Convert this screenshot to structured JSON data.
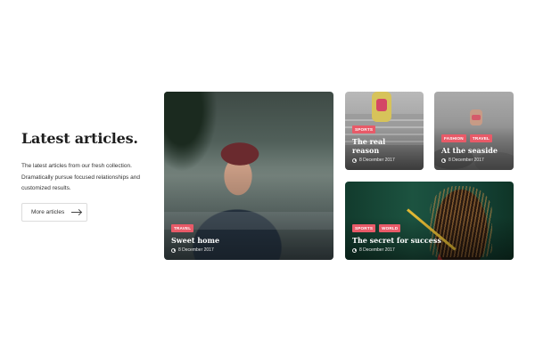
{
  "section": {
    "title": "Latest articles.",
    "description": "The latest articles from our fresh collection. Dramatically pursue focused relationships and customized results.",
    "more_button_label": "More articles"
  },
  "articles": [
    {
      "title": "Sweet home",
      "date": "8 December 2017",
      "tags": [
        "TRAVEL"
      ]
    },
    {
      "title": "The real reason",
      "date": "8 December 2017",
      "tags": [
        "SPORTS"
      ]
    },
    {
      "title": "At the seaside",
      "date": "8 December 2017",
      "tags": [
        "FASHION",
        "TRAVEL"
      ]
    },
    {
      "title": "The secret for success",
      "date": "8 December 2017",
      "tags": [
        "SPORTS",
        "WORLD"
      ]
    }
  ],
  "colors": {
    "tag": "#e85a68",
    "heading": "#1e1e1e",
    "background": "#ffffff"
  },
  "icons": {
    "date": "clock-icon",
    "button": "arrow-right-icon"
  }
}
